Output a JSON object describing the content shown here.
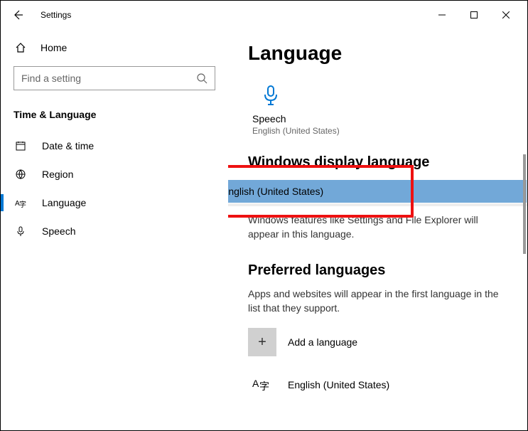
{
  "titlebar": {
    "title": "Settings"
  },
  "sidebar": {
    "home": "Home",
    "search_placeholder": "Find a setting",
    "category": "Time & Language",
    "items": [
      {
        "label": "Date & time"
      },
      {
        "label": "Region"
      },
      {
        "label": "Language"
      },
      {
        "label": "Speech"
      }
    ]
  },
  "content": {
    "title": "Language",
    "speech_tile": {
      "title": "Speech",
      "subtitle": "English (United States)"
    },
    "display_lang": {
      "header": "Windows display language",
      "selected": "English (United States)",
      "description": "Windows features like Settings and File Explorer will appear in this language."
    },
    "preferred": {
      "header": "Preferred languages",
      "description": "Apps and websites will appear in the first language in the list that they support.",
      "add_label": "Add a language",
      "items": [
        {
          "label": "English (United States)"
        }
      ]
    }
  }
}
